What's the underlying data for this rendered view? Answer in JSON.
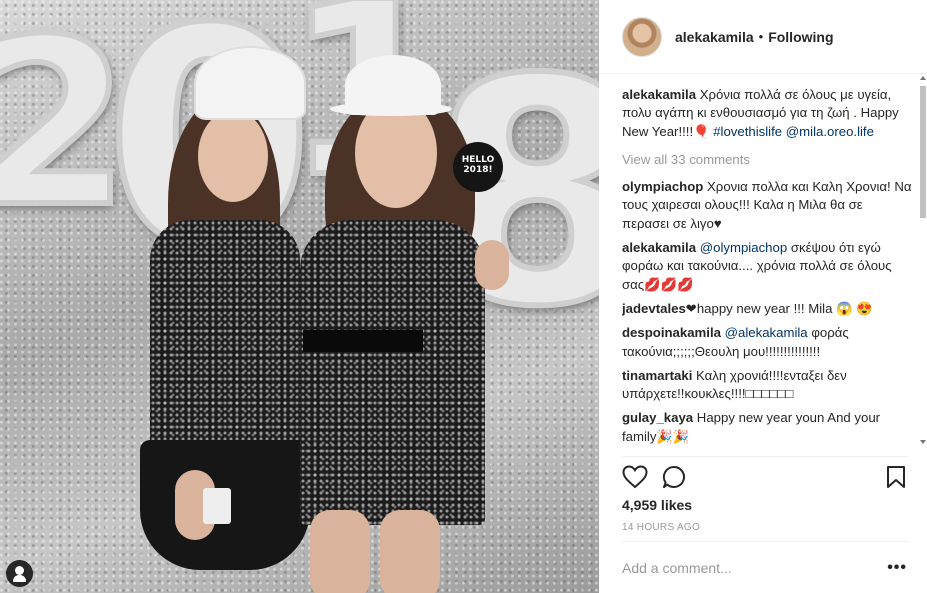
{
  "post": {
    "username": "alekakamila",
    "separator": "•",
    "follow_status": "Following",
    "caption": {
      "username": "alekakamila",
      "text": "Χρόνια πολλά σε όλους με υγεία, πολυ αγάπη κι ενθουσιασμό για τη ζωή . Happy New Year!!!!🎈",
      "hashtag": "#lovethislife",
      "mention": "@mila.oreo.life"
    },
    "view_all": "View all 33 comments",
    "comments": [
      {
        "user": "olympiachop",
        "mention": "",
        "text": "Χρονια πολλα και Καλη Χρονια! Να τους χαιρεσαι ολους!!! Καλα η Μιλα θα σε περασει σε λιγο♥"
      },
      {
        "user": "alekakamila",
        "mention": "@olympiachop",
        "text": " σκέψου ότι εγώ φοράω και τακούνια.... χρόνια πολλά σε όλους σας💋💋💋"
      },
      {
        "user": "jadevtales",
        "mention": "",
        "text": "❤happy new year !!! Mila 😱 😍"
      },
      {
        "user": "despoinakamila",
        "mention": "@alekakamila",
        "text": " φοράς τακούνια;;;;;;Θεουλη μου!!!!!!!!!!!!!!!"
      },
      {
        "user": "tinamartaki",
        "mention": "",
        "text": "Καλη χρονιά!!!!ενταξει δεν υπάρχετε!!κουκλες!!!!□□□□□□"
      },
      {
        "user": "gulay_kaya",
        "mention": "",
        "text": "Happy new year youn And your family🎉🎉"
      }
    ],
    "likes": "4,959 likes",
    "timestamp": "14 HOURS AGO",
    "comment_placeholder": "Add a comment...",
    "more": "•••",
    "photo": {
      "balloon_text": "2018",
      "sign_text": "HELLO 2018!"
    },
    "icons": [
      "heart-icon",
      "comment-icon",
      "bookmark-icon",
      "user-tag-icon",
      "options-icon"
    ]
  }
}
